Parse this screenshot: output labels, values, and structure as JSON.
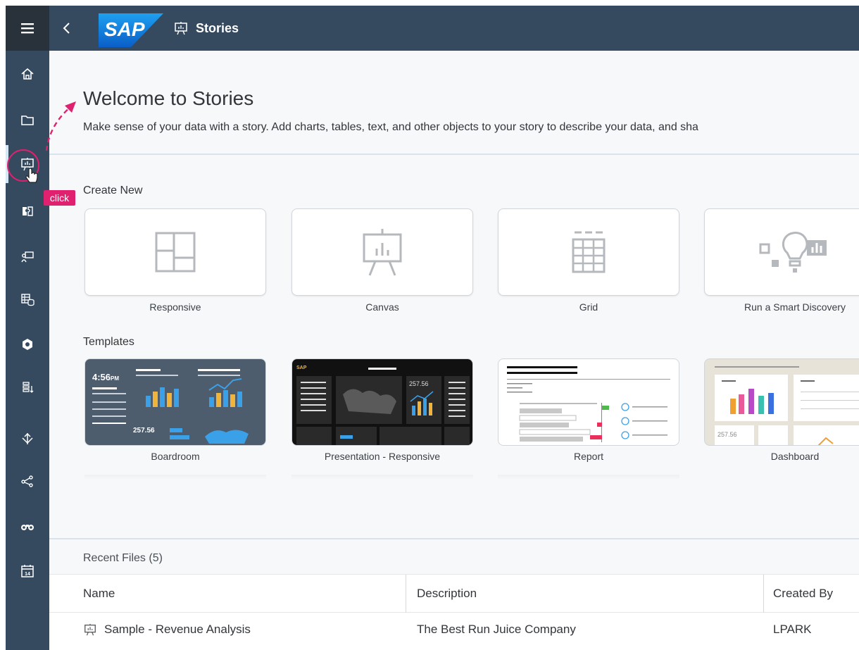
{
  "header": {
    "logo_text": "SAP",
    "title": "Stories"
  },
  "rail": {
    "items": [
      {
        "name": "menu-icon"
      },
      {
        "name": "home-icon"
      },
      {
        "name": "folder-icon"
      },
      {
        "name": "stories-icon"
      },
      {
        "name": "analytic-app-icon"
      },
      {
        "name": "digital-boardroom-icon"
      },
      {
        "name": "data-icon"
      },
      {
        "name": "modeler-icon"
      },
      {
        "name": "predictive-icon"
      },
      {
        "name": "data-integration-icon"
      },
      {
        "name": "connections-icon"
      },
      {
        "name": "discovery-icon"
      },
      {
        "name": "calendar-icon"
      }
    ],
    "calendar_day": "14"
  },
  "welcome": {
    "title": "Welcome to Stories",
    "subtitle": "Make sense of your data with a story. Add charts, tables, text, and other objects to your story to describe your data, and sha"
  },
  "create_new": {
    "label": "Create New",
    "tiles": [
      {
        "label": "Responsive",
        "icon": "responsive-layout-icon"
      },
      {
        "label": "Canvas",
        "icon": "canvas-presentation-icon"
      },
      {
        "label": "Grid",
        "icon": "grid-table-icon"
      },
      {
        "label": "Run a Smart Discovery",
        "icon": "smart-discovery-icon"
      }
    ]
  },
  "templates": {
    "label": "Templates",
    "items": [
      {
        "label": "Boardroom",
        "time_text": "4:56",
        "time_suffix": "PM",
        "value_text": "257.56"
      },
      {
        "label": "Presentation - Responsive",
        "logo_text": "SAP",
        "value_text": "257.56"
      },
      {
        "label": "Report"
      },
      {
        "label": "Dashboard",
        "value_text": "257.56"
      }
    ]
  },
  "recent_files": {
    "title": "Recent Files (5)",
    "columns": [
      "Name",
      "Description",
      "Created By"
    ],
    "rows": [
      {
        "name": "Sample - Revenue Analysis",
        "description": "The Best Run Juice Company",
        "created_by": "LPARK"
      }
    ]
  },
  "annotation": {
    "click_label": "click"
  },
  "colors": {
    "shell": "#354a5f",
    "accent_pink": "#e0216f",
    "sap_blue": "#0a6ed1"
  }
}
